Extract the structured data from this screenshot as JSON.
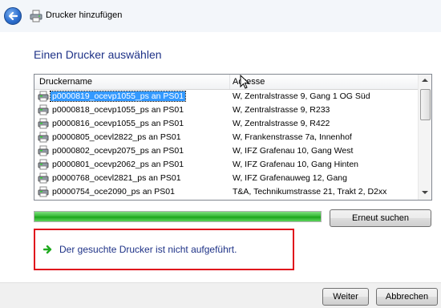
{
  "window": {
    "title": "Drucker hinzufügen"
  },
  "heading": "Einen Drucker auswählen",
  "list": {
    "columns": {
      "name": "Druckername",
      "address": "Adresse"
    },
    "rows": [
      {
        "name": "p0000819_ocevp1055_ps an PS01",
        "address": "W, Zentralstrasse 9, Gang 1 OG Süd",
        "selected": true
      },
      {
        "name": "p0000818_ocevp1055_ps an PS01",
        "address": "W, Zentralstrasse 9, R233"
      },
      {
        "name": "p0000816_ocevp1055_ps an PS01",
        "address": "W, Zentralstrasse 9, R422"
      },
      {
        "name": "p0000805_ocevl2822_ps an PS01",
        "address": "W, Frankenstrasse 7a, Innenhof"
      },
      {
        "name": "p0000802_ocevp2075_ps an PS01",
        "address": "W, IFZ Grafenau 10, Gang West"
      },
      {
        "name": "p0000801_ocevp2062_ps an PS01",
        "address": "W, IFZ Grafenau 10, Gang Hinten"
      },
      {
        "name": "p0000768_ocevl2821_ps an PS01",
        "address": "W, IFZ Grafenauweg 12, Gang"
      },
      {
        "name": "p0000754_oce2090_ps an PS01",
        "address": "T&A, Technikumstrasse 21, Trakt 2, D2xx"
      }
    ]
  },
  "search": {
    "progress": 1.0,
    "retry_label": "Erneut suchen"
  },
  "not_found_link": "Der gesuchte Drucker ist nicht aufgeführt.",
  "footer": {
    "next_label": "Weiter",
    "cancel_label": "Abbrechen"
  },
  "icons": {
    "back": "back-arrow-icon",
    "printer": "printer-icon",
    "link_arrow": "green-arrow-icon"
  },
  "colors": {
    "heading": "#1e3287",
    "selection": "#3399ff",
    "highlight_box": "#e0101c",
    "progress": "#2fb52f"
  }
}
